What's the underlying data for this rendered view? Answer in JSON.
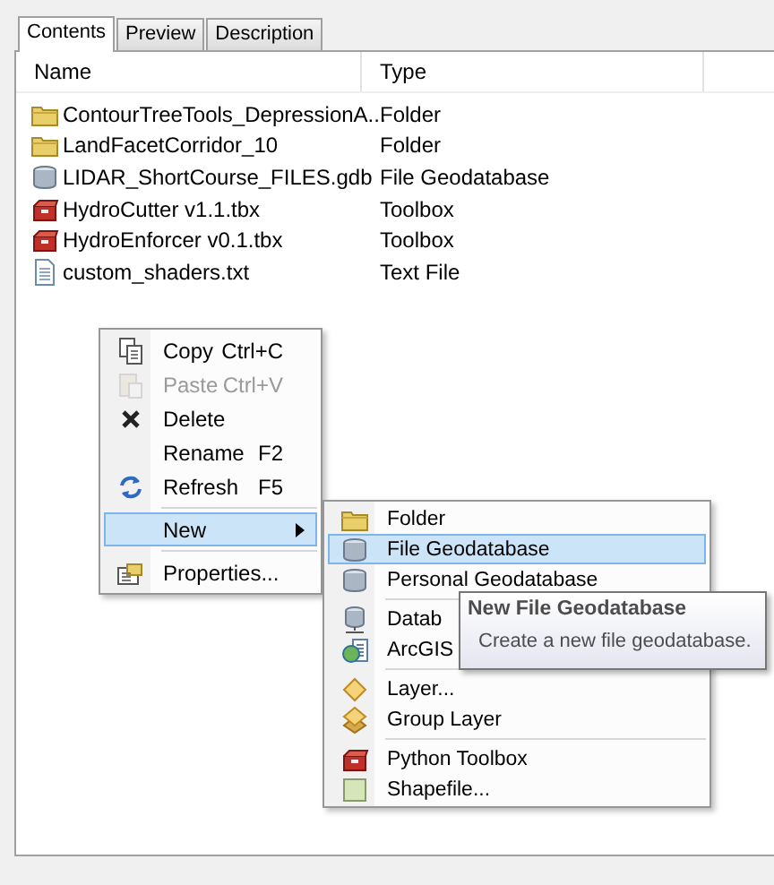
{
  "tabs": [
    {
      "label": "Contents",
      "selected": true
    },
    {
      "label": "Preview",
      "selected": false
    },
    {
      "label": "Description",
      "selected": false
    }
  ],
  "columns": [
    "Name",
    "Type"
  ],
  "files": [
    {
      "kind": "folder",
      "name": "ContourTreeTools_DepressionA...",
      "type": "Folder"
    },
    {
      "kind": "folder",
      "name": "LandFacetCorridor_10",
      "type": "Folder"
    },
    {
      "kind": "geodatabase",
      "name": "LIDAR_ShortCourse_FILES.gdb",
      "type": "File Geodatabase"
    },
    {
      "kind": "toolbox",
      "name": "HydroCutter v1.1.tbx",
      "type": "Toolbox"
    },
    {
      "kind": "toolbox",
      "name": "HydroEnforcer v0.1.tbx",
      "type": "Toolbox"
    },
    {
      "kind": "textfile",
      "name": "custom_shaders.txt",
      "type": "Text File"
    }
  ],
  "context_menu": {
    "items": [
      {
        "kind": "copy",
        "label": "Copy",
        "shortcut": "Ctrl+C",
        "disabled": false,
        "selected": false
      },
      {
        "kind": "paste",
        "label": "Paste",
        "shortcut": "Ctrl+V",
        "disabled": true,
        "selected": false
      },
      {
        "kind": "delete",
        "label": "Delete",
        "disabled": false,
        "selected": false
      },
      {
        "kind": "plain",
        "label": "Rename",
        "shortcut": "F2",
        "disabled": false,
        "selected": false
      },
      {
        "kind": "refresh",
        "label": "Refresh",
        "shortcut": "F5",
        "disabled": false,
        "selected": false
      },
      {
        "kind": "separator"
      },
      {
        "kind": "plain",
        "label": "New",
        "submenu": true,
        "disabled": false,
        "selected": true
      },
      {
        "kind": "separator"
      },
      {
        "kind": "properties",
        "label": "Properties...",
        "disabled": false,
        "selected": false
      }
    ]
  },
  "new_submenu": {
    "items": [
      {
        "kind": "folder",
        "label": "Folder",
        "selected": false
      },
      {
        "kind": "geodatabase",
        "label": "File Geodatabase",
        "selected": true
      },
      {
        "kind": "geodatabase",
        "label": "Personal Geodatabase",
        "selected": false
      },
      {
        "kind": "separator"
      },
      {
        "kind": "database",
        "label": "Datab",
        "selected": false
      },
      {
        "kind": "server",
        "label": "ArcGIS",
        "selected": false
      },
      {
        "kind": "separator"
      },
      {
        "kind": "layer",
        "label": "Layer...",
        "selected": false
      },
      {
        "kind": "grouplayer",
        "label": "Group Layer",
        "selected": false
      },
      {
        "kind": "separator"
      },
      {
        "kind": "toolbox",
        "label": "Python Toolbox",
        "selected": false
      },
      {
        "kind": "shapefile",
        "label": "Shapefile...",
        "selected": false
      }
    ]
  },
  "tooltip": {
    "title": "New File Geodatabase",
    "text": "Create a new file geodatabase."
  }
}
